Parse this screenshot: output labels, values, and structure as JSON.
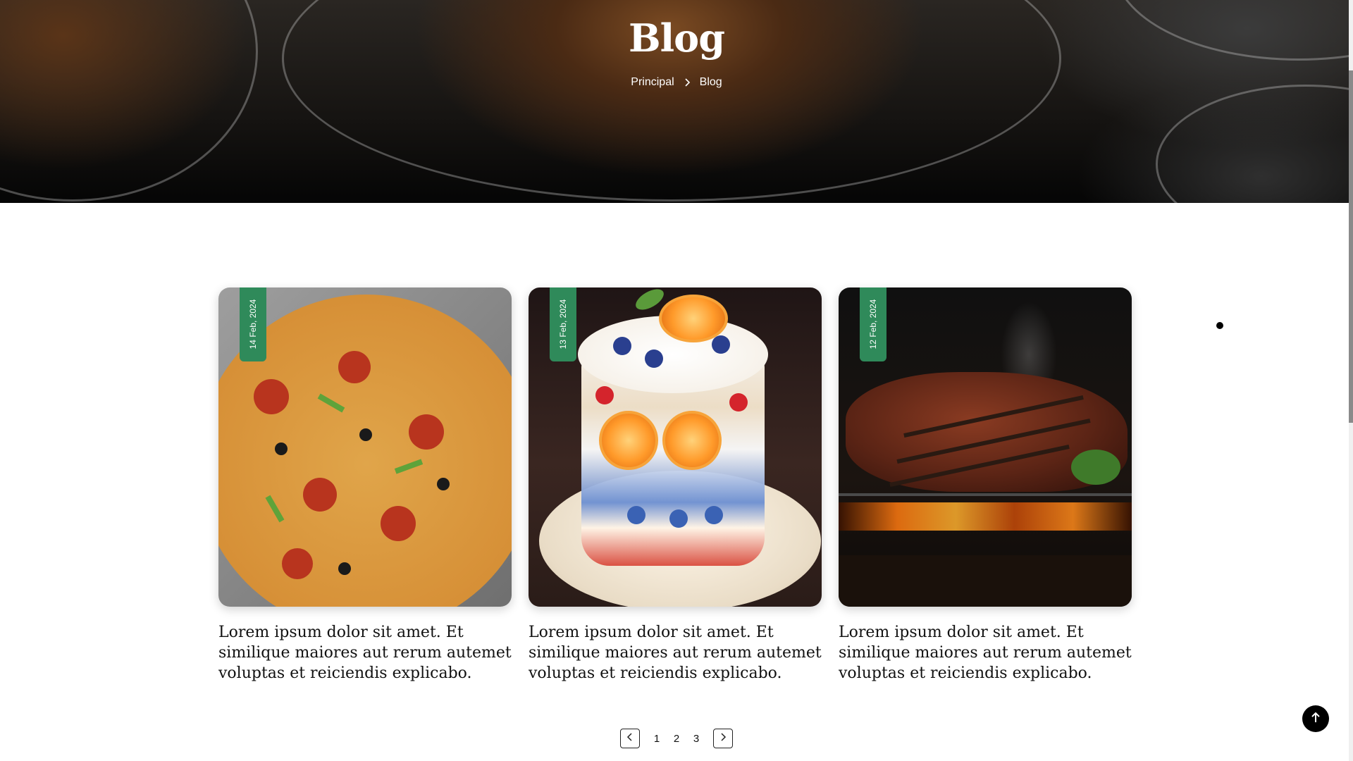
{
  "hero": {
    "title": "Blog",
    "breadcrumb": {
      "home": "Principal",
      "current": "Blog"
    }
  },
  "posts": [
    {
      "date": "14 Feb, 2024",
      "image": "pizza",
      "excerpt": "Lorem ipsum dolor sit amet. Et similique maiores aut rerum autemet voluptas et reiciendis explicabo."
    },
    {
      "date": "13 Feb, 2024",
      "image": "fruit-parfait-dessert",
      "excerpt": "Lorem ipsum dolor sit amet. Et similique maiores aut rerum autemet voluptas et reiciendis explicabo."
    },
    {
      "date": "12 Feb, 2024",
      "image": "grilled-steak",
      "excerpt": "Lorem ipsum dolor sit amet. Et similique maiores aut rerum autemet voluptas et reiciendis explicabo."
    }
  ],
  "pagination": {
    "pages": [
      "1",
      "2",
      "3"
    ],
    "prev_icon": "chevron-left-icon",
    "next_icon": "chevron-right-icon"
  },
  "colors": {
    "date_tag": "#2f8a5a",
    "hero_text": "#ffffff",
    "body_text": "#111111"
  },
  "icons": {
    "breadcrumb_separator": "chevron-right-icon",
    "scroll_to_top": "arrow-up-icon"
  }
}
